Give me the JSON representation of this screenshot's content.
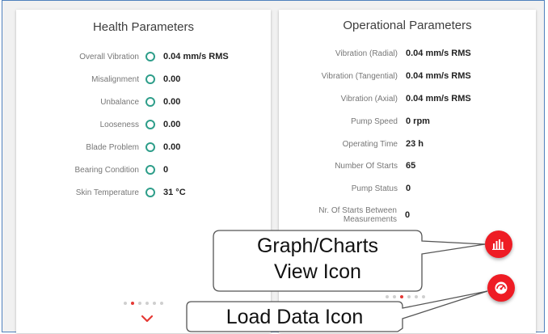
{
  "health": {
    "title": "Health Parameters",
    "items": [
      {
        "label": "Overall Vibration",
        "value": "0.04 mm/s RMS"
      },
      {
        "label": "Misalignment",
        "value": "0.00"
      },
      {
        "label": "Unbalance",
        "value": "0.00"
      },
      {
        "label": "Looseness",
        "value": "0.00"
      },
      {
        "label": "Blade Problem",
        "value": "0.00"
      },
      {
        "label": "Bearing Condition",
        "value": "0"
      },
      {
        "label": "Skin Temperature",
        "value": "31 °C"
      }
    ]
  },
  "operational": {
    "title": "Operational Parameters",
    "items": [
      {
        "label": "Vibration (Radial)",
        "value": "0.04 mm/s RMS"
      },
      {
        "label": "Vibration (Tangential)",
        "value": "0.04 mm/s RMS"
      },
      {
        "label": "Vibration (Axial)",
        "value": "0.04 mm/s RMS"
      },
      {
        "label": "Pump Speed",
        "value": "0 rpm"
      },
      {
        "label": "Operating Time",
        "value": "23 h"
      },
      {
        "label": "Number Of Starts",
        "value": "65"
      },
      {
        "label": "Pump Status",
        "value": "0"
      },
      {
        "label": "Nr. Of Starts Between Measurements",
        "value": "0"
      }
    ]
  },
  "pagination": {
    "left_active_index": 1,
    "right_active_index": 2,
    "count": 6
  },
  "callouts": {
    "graph_line1": "Graph/Charts",
    "graph_line2": "View Icon",
    "load": "Load Data Icon"
  },
  "icons": {
    "status": "status-ring-icon",
    "graph": "bar-chart-icon",
    "load": "gauge-icon",
    "expand": "chevron-down-icon"
  },
  "colors": {
    "accent": "#ee1c24",
    "status_ring": "#2e9e8a",
    "frame_border": "#4f81bd"
  }
}
